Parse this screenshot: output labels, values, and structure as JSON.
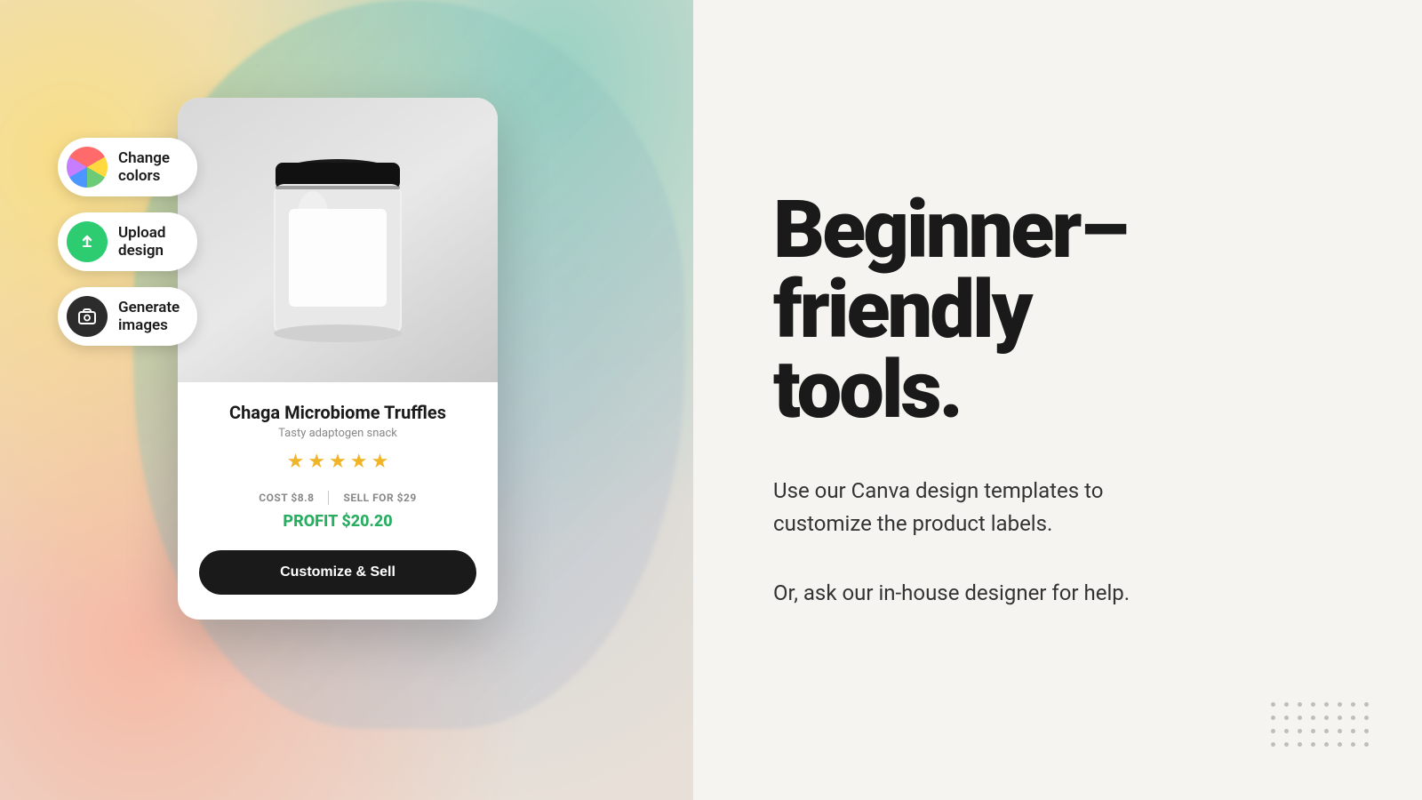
{
  "left": {
    "tools": [
      {
        "id": "change-colors",
        "label": "Change\ncolors",
        "label_line1": "Change",
        "label_line2": "colors",
        "icon_type": "colors"
      },
      {
        "id": "upload-design",
        "label": "Upload\ndesign",
        "label_line1": "Upload",
        "label_line2": "design",
        "icon_type": "upload"
      },
      {
        "id": "generate-images",
        "label": "Generate\nimages",
        "label_line1": "Generate",
        "label_line2": "images",
        "icon_type": "camera"
      }
    ],
    "product_card": {
      "product_name": "Chaga Microbiome Truffles",
      "product_subtitle": "Tasty adaptogen snack",
      "stars_count": 5,
      "cost_label": "COST $8.8",
      "sell_label": "SELL FOR $29",
      "profit_label": "PROFIT $20.20",
      "button_label": "Customize & Sell"
    }
  },
  "right": {
    "headline_line1": "Beginner–",
    "headline_line2": "friendly",
    "headline_line3": "tools.",
    "description1": "Use our Canva design templates to customize the product labels.",
    "description2": "Or, ask our in-house designer for help."
  }
}
